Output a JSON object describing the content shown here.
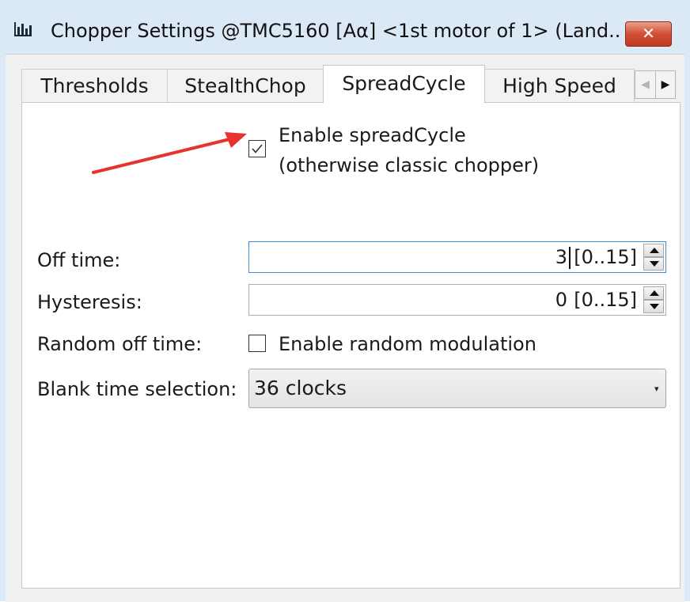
{
  "window": {
    "title": "Chopper Settings @TMC5160 [Aα] <1st motor of 1> (Land...",
    "close_label": "✕"
  },
  "tabs": [
    {
      "label": "Thresholds",
      "active": false
    },
    {
      "label": "StealthChop",
      "active": false
    },
    {
      "label": "SpreadCycle",
      "active": true
    },
    {
      "label": "High Speed",
      "active": false
    }
  ],
  "tab_scroll": {
    "left": "◀",
    "right": "▶"
  },
  "spreadcycle": {
    "enable_label_line1": "Enable spreadCycle",
    "enable_label_line2": "(otherwise classic chopper)",
    "enable_checked": true,
    "off_time": {
      "label": "Off time:",
      "value": "3",
      "range": "[0..15]"
    },
    "hysteresis": {
      "label": "Hysteresis:",
      "value": "0",
      "range": "[0..15]"
    },
    "random_off_time": {
      "label": "Random off time:",
      "checkbox_label": "Enable random modulation",
      "checked": false
    },
    "blank_time": {
      "label": "Blank time selection:",
      "selected": "36 clocks"
    }
  },
  "colors": {
    "annotation_arrow": "#e8322d",
    "focus_border": "#3c8fd8",
    "titlebar": "#dbe8f6"
  },
  "icons": {
    "app": "chart-bars-icon",
    "close": "close-icon",
    "check": "checkmark-icon"
  }
}
